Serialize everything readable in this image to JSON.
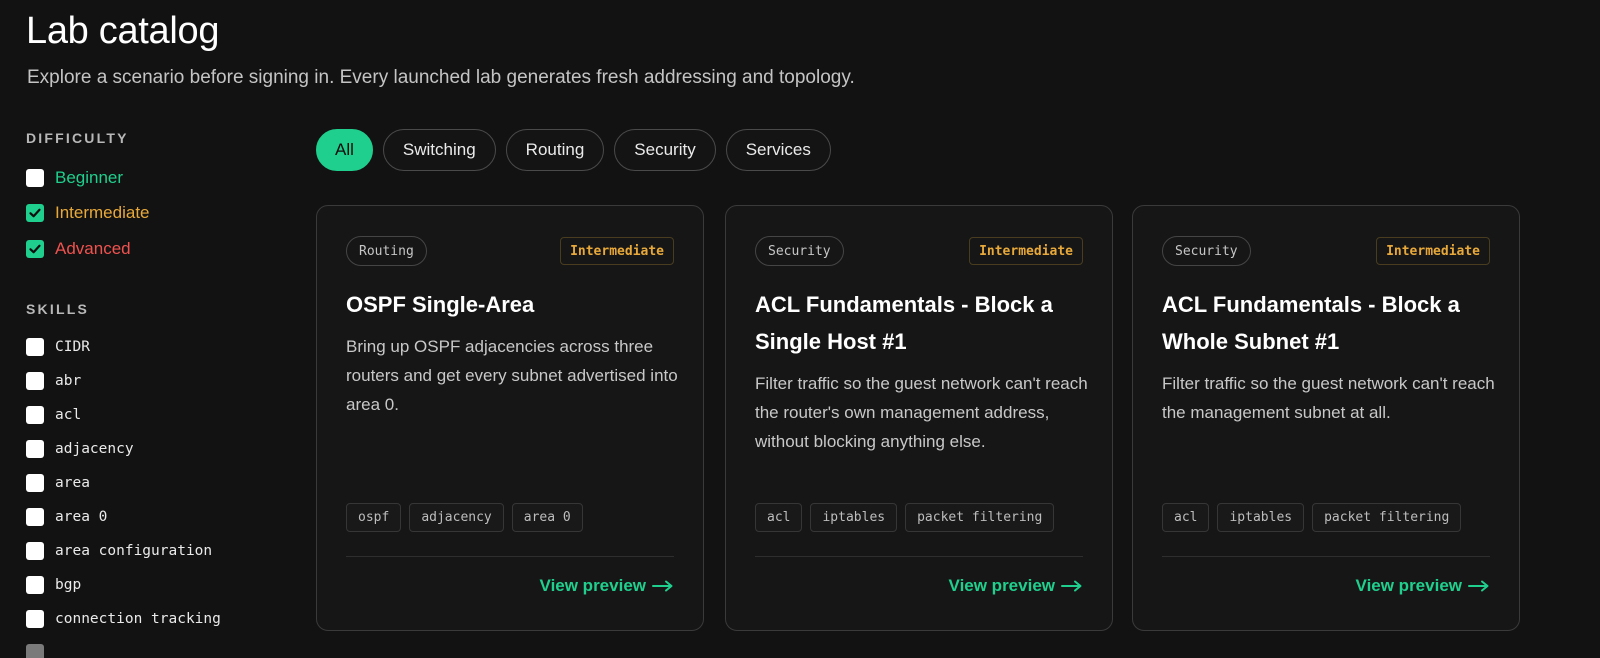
{
  "header": {
    "title": "Lab catalog",
    "subtitle": "Explore a scenario before signing in. Every launched lab generates fresh addressing and topology."
  },
  "sidebar": {
    "difficulty_heading": "DIFFICULTY",
    "difficulty": [
      {
        "label": "Beginner",
        "checked": false,
        "color": "#1fcf8d"
      },
      {
        "label": "Intermediate",
        "checked": true,
        "color": "#e8a93a"
      },
      {
        "label": "Advanced",
        "checked": true,
        "color": "#f0524f"
      }
    ],
    "skills_heading": "SKILLS",
    "skills": [
      {
        "label": "CIDR",
        "checked": false
      },
      {
        "label": "abr",
        "checked": false
      },
      {
        "label": "acl",
        "checked": false
      },
      {
        "label": "adjacency",
        "checked": false
      },
      {
        "label": "area",
        "checked": false
      },
      {
        "label": "area 0",
        "checked": false
      },
      {
        "label": "area configuration",
        "checked": false
      },
      {
        "label": "bgp",
        "checked": false
      },
      {
        "label": "connection tracking",
        "checked": false
      }
    ]
  },
  "filters": {
    "tabs": [
      {
        "label": "All",
        "active": true
      },
      {
        "label": "Switching",
        "active": false
      },
      {
        "label": "Routing",
        "active": false
      },
      {
        "label": "Security",
        "active": false
      },
      {
        "label": "Services",
        "active": false
      }
    ]
  },
  "cards": [
    {
      "category": "Routing",
      "level": "Intermediate",
      "title": "OSPF Single-Area",
      "description": "Bring up OSPF adjacencies across three routers and get every subnet advertised into area 0.",
      "tags": [
        "ospf",
        "adjacency",
        "area 0"
      ],
      "cta": "View preview",
      "cta_icon": "arrow-right-icon"
    },
    {
      "category": "Security",
      "level": "Intermediate",
      "title": "ACL Fundamentals - Block a Single Host #1",
      "description": "Filter traffic so the guest network can't reach the router's own management address, without blocking anything else.",
      "tags": [
        "acl",
        "iptables",
        "packet filtering"
      ],
      "cta": "View preview",
      "cta_icon": "arrow-right-icon"
    },
    {
      "category": "Security",
      "level": "Intermediate",
      "title": "ACL Fundamentals - Block a Whole Subnet #1",
      "description": "Filter traffic so the guest network can't reach the management subnet at all.",
      "tags": [
        "acl",
        "iptables",
        "packet filtering"
      ],
      "cta": "View preview",
      "cta_icon": "arrow-right-icon"
    }
  ],
  "colors": {
    "accent": "#1fcf8d",
    "intermediate": "#e8a93a",
    "advanced": "#f0524f",
    "background": "#121212"
  }
}
